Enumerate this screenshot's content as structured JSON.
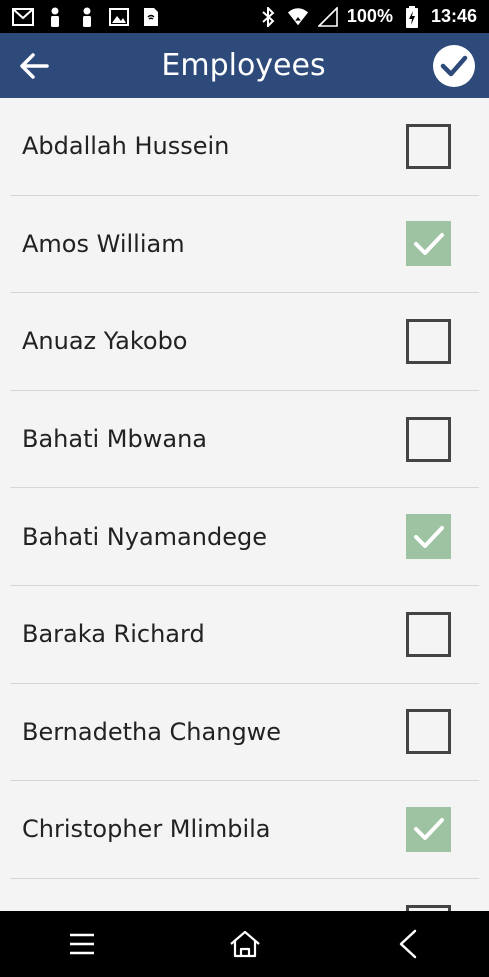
{
  "status_bar": {
    "battery": "100%",
    "time": "13:46",
    "icons": [
      "gmail-icon",
      "person-icon",
      "person-icon",
      "image-icon",
      "sim-icon",
      "bluetooth-icon",
      "wifi-icon",
      "signal-icon",
      "battery-charging-icon"
    ]
  },
  "app_bar": {
    "title": "Employees",
    "back_icon": "arrow-left-icon",
    "confirm_icon": "check-circle-icon"
  },
  "employees": [
    {
      "name": "Abdallah Hussein",
      "checked": false
    },
    {
      "name": "Amos William",
      "checked": true
    },
    {
      "name": "Anuaz Yakobo",
      "checked": false
    },
    {
      "name": "Bahati Mbwana",
      "checked": false
    },
    {
      "name": "Bahati Nyamandege",
      "checked": true
    },
    {
      "name": "Baraka Richard",
      "checked": false
    },
    {
      "name": "Bernadetha Changwe",
      "checked": false
    },
    {
      "name": "Christopher Mlimbila",
      "checked": true
    },
    {
      "name": "",
      "checked": false
    }
  ],
  "colors": {
    "app_bar": "#2d4a7a",
    "checked": "#9ec3a2",
    "background": "#f4f4f4"
  },
  "nav_bar": {
    "icons": [
      "menu-icon",
      "home-icon",
      "back-icon"
    ]
  }
}
